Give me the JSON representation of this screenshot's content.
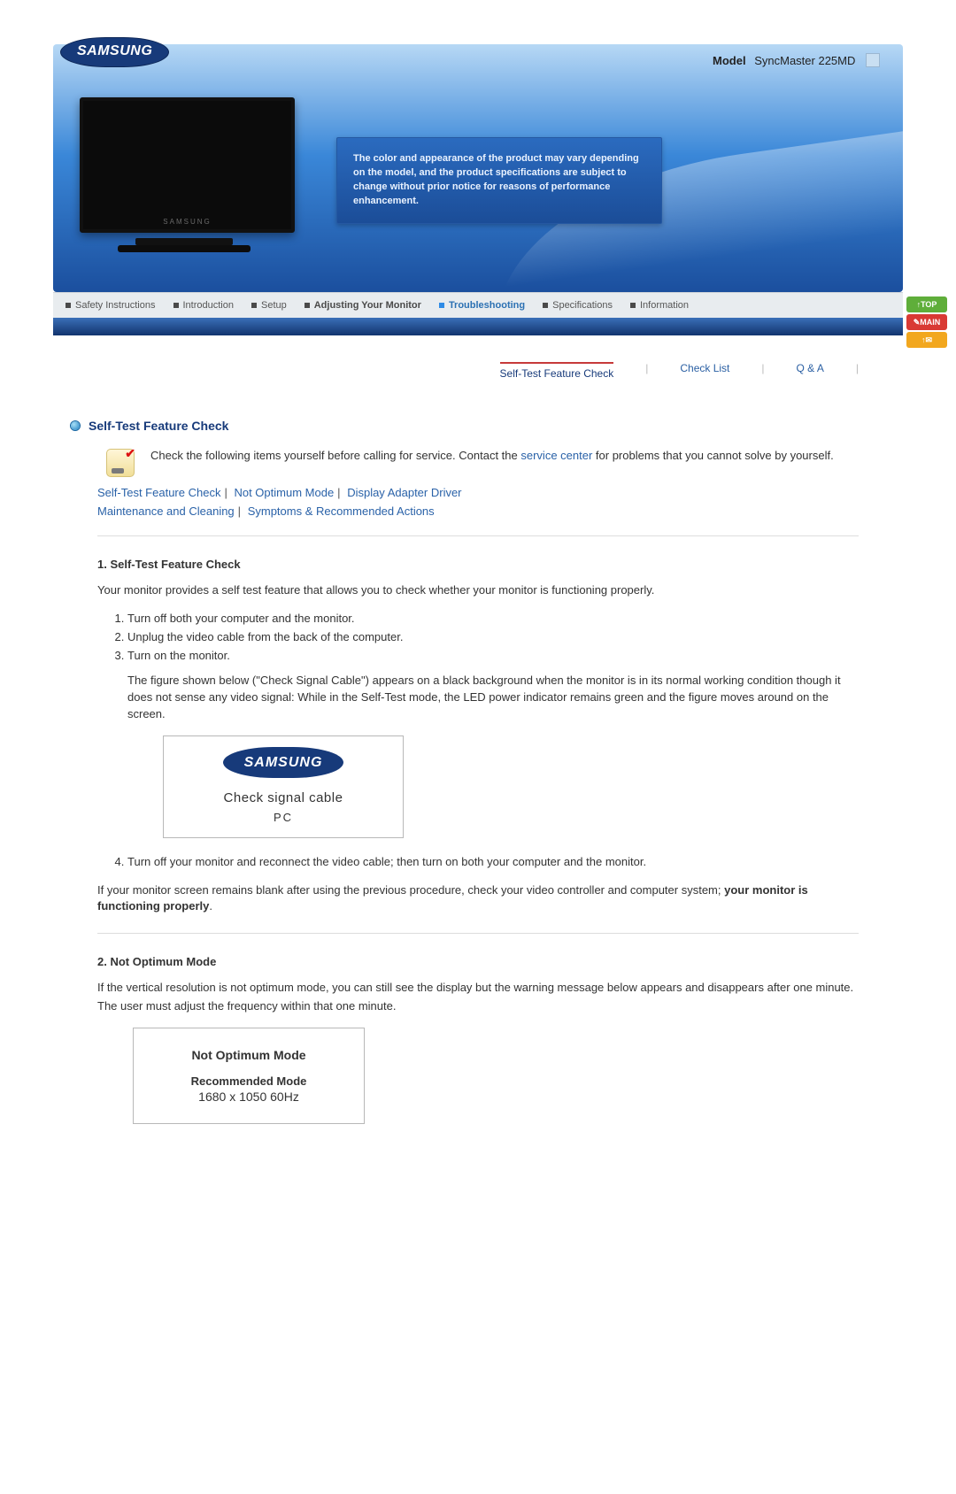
{
  "brand": "SAMSUNG",
  "model_label": "Model",
  "model_value": "SyncMaster 225MD",
  "info_box": "The color and appearance of the product may vary depending on the model, and the product specifications are subject to change without prior notice for reasons of performance enhancement.",
  "nav": {
    "items": [
      {
        "label": "Safety Instructions",
        "active": false,
        "bold": false
      },
      {
        "label": "Introduction",
        "active": false,
        "bold": false
      },
      {
        "label": "Setup",
        "active": false,
        "bold": false
      },
      {
        "label": "Adjusting Your Monitor",
        "active": false,
        "bold": true
      },
      {
        "label": "Troubleshooting",
        "active": true,
        "bold": true
      },
      {
        "label": "Specifications",
        "active": false,
        "bold": false
      },
      {
        "label": "Information",
        "active": false,
        "bold": false
      }
    ]
  },
  "side": {
    "top": "TOP",
    "main": "MAIN",
    "mail": "✉"
  },
  "subnav": {
    "items": [
      "Self-Test Feature Check",
      "Check List",
      "Q & A"
    ],
    "selected_index": 0
  },
  "section": {
    "title": "Self-Test Feature Check",
    "intro_pre": "Check the following items yourself before calling for service. Contact the ",
    "intro_link": "service center",
    "intro_post": " for problems that you cannot solve by yourself.",
    "links1": [
      "Self-Test Feature Check",
      "Not Optimum Mode",
      "Display Adapter Driver"
    ],
    "links2": [
      "Maintenance and Cleaning",
      "Symptoms & Recommended Actions"
    ]
  },
  "s1": {
    "heading": "1. Self-Test Feature Check",
    "p1": "Your monitor provides a self test feature that allows you to check whether your monitor is functioning properly.",
    "steps": [
      "Turn off both your computer and the monitor.",
      "Unplug the video cable from the back of the computer.",
      "Turn on the monitor."
    ],
    "step3_note": "The figure shown below (\"Check Signal Cable\") appears on a black background when the monitor is in its normal working condition though it does not sense any video signal: While in the Self-Test mode, the LED power indicator remains green and the figure moves around on the screen.",
    "fig": {
      "brand": "SAMSUNG",
      "line1": "Check signal cable",
      "line2": "PC"
    },
    "step4": "Turn off your monitor and reconnect the video cable; then turn on both your computer and the monitor.",
    "closing_pre": "If your monitor screen remains blank after using the previous procedure, check your video controller and computer system; ",
    "closing_bold": "your monitor is functioning properly",
    "closing_post": "."
  },
  "s2": {
    "heading": "2. Not Optimum Mode",
    "p1": "If the vertical resolution is not optimum mode, you can still see the display but the warning message below appears and disappears after one minute.",
    "p2": "The user must adjust the frequency within that one minute.",
    "fig": {
      "l1": "Not Optimum Mode",
      "l2": "Recommended Mode",
      "l3": "1680 x 1050  60Hz"
    }
  }
}
